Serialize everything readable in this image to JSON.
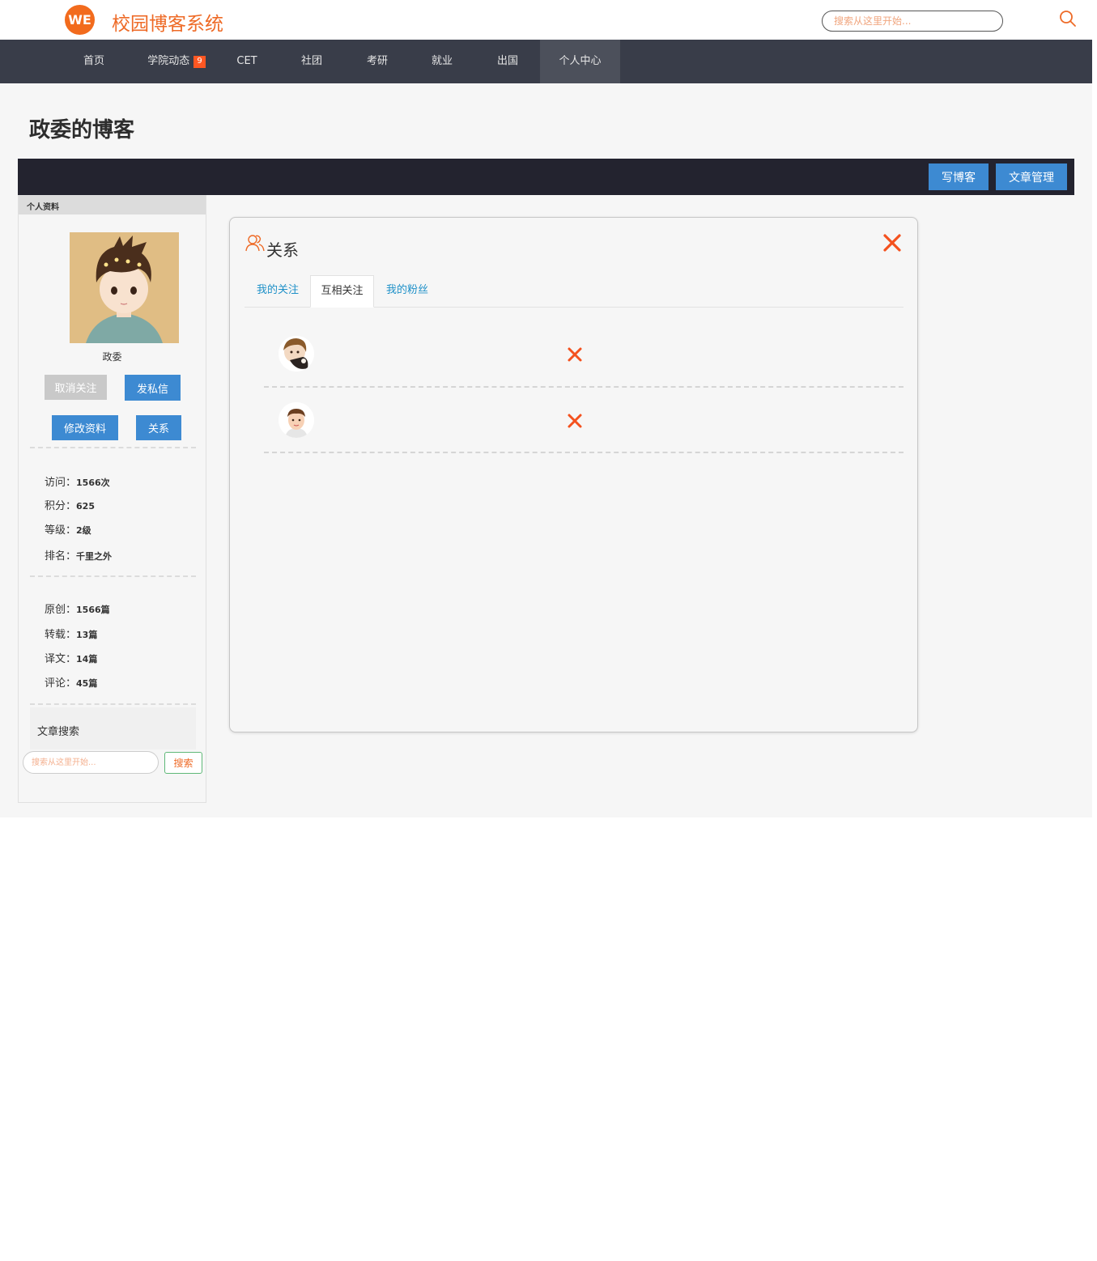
{
  "header": {
    "logo_text": "WE",
    "site_title": "校园博客系统",
    "search_placeholder": "搜索从这里开始..."
  },
  "nav": {
    "items": [
      {
        "label": "首页"
      },
      {
        "label": "学院动态",
        "badge": "9"
      },
      {
        "label": "CET"
      },
      {
        "label": "社团"
      },
      {
        "label": "考研"
      },
      {
        "label": "就业"
      },
      {
        "label": "出国"
      },
      {
        "label": "个人中心",
        "active": true
      }
    ]
  },
  "blog": {
    "title": "政委的博客",
    "write_button": "写博客",
    "manage_button": "文章管理"
  },
  "sidebar": {
    "header": "个人资料",
    "user_name": "政委",
    "unfollow_button": "取消关注",
    "message_button": "发私信",
    "edit_button": "修改资料",
    "relation_button": "关系",
    "stats1": [
      {
        "label": "访问：",
        "value": "1566次"
      },
      {
        "label": "积分：",
        "value": "625"
      },
      {
        "label": "等级：",
        "value": "2级"
      },
      {
        "label": "排名：",
        "value": "千里之外"
      }
    ],
    "stats2": [
      {
        "label": "原创：",
        "value": "1566篇"
      },
      {
        "label": "转载：",
        "value": "13篇"
      },
      {
        "label": "译文：",
        "value": "14篇"
      },
      {
        "label": "评论：",
        "value": "45篇"
      }
    ],
    "search_label": "文章搜索",
    "search_placeholder": "搜索从这里开始...",
    "search_button": "搜索"
  },
  "relation_panel": {
    "title": "关系",
    "tabs": [
      {
        "label": "我的关注"
      },
      {
        "label": "互相关注",
        "active": true
      },
      {
        "label": "我的粉丝"
      }
    ],
    "rows": [
      {
        "avatar": "avatar-1-icon"
      },
      {
        "avatar": "avatar-2-icon"
      }
    ]
  },
  "colors": {
    "accent_orange": "#ee6a26",
    "nav_bg": "#393d49",
    "button_blue": "#3d8ad2",
    "dark_bar": "#23232f",
    "close_orange": "#f4511e"
  }
}
